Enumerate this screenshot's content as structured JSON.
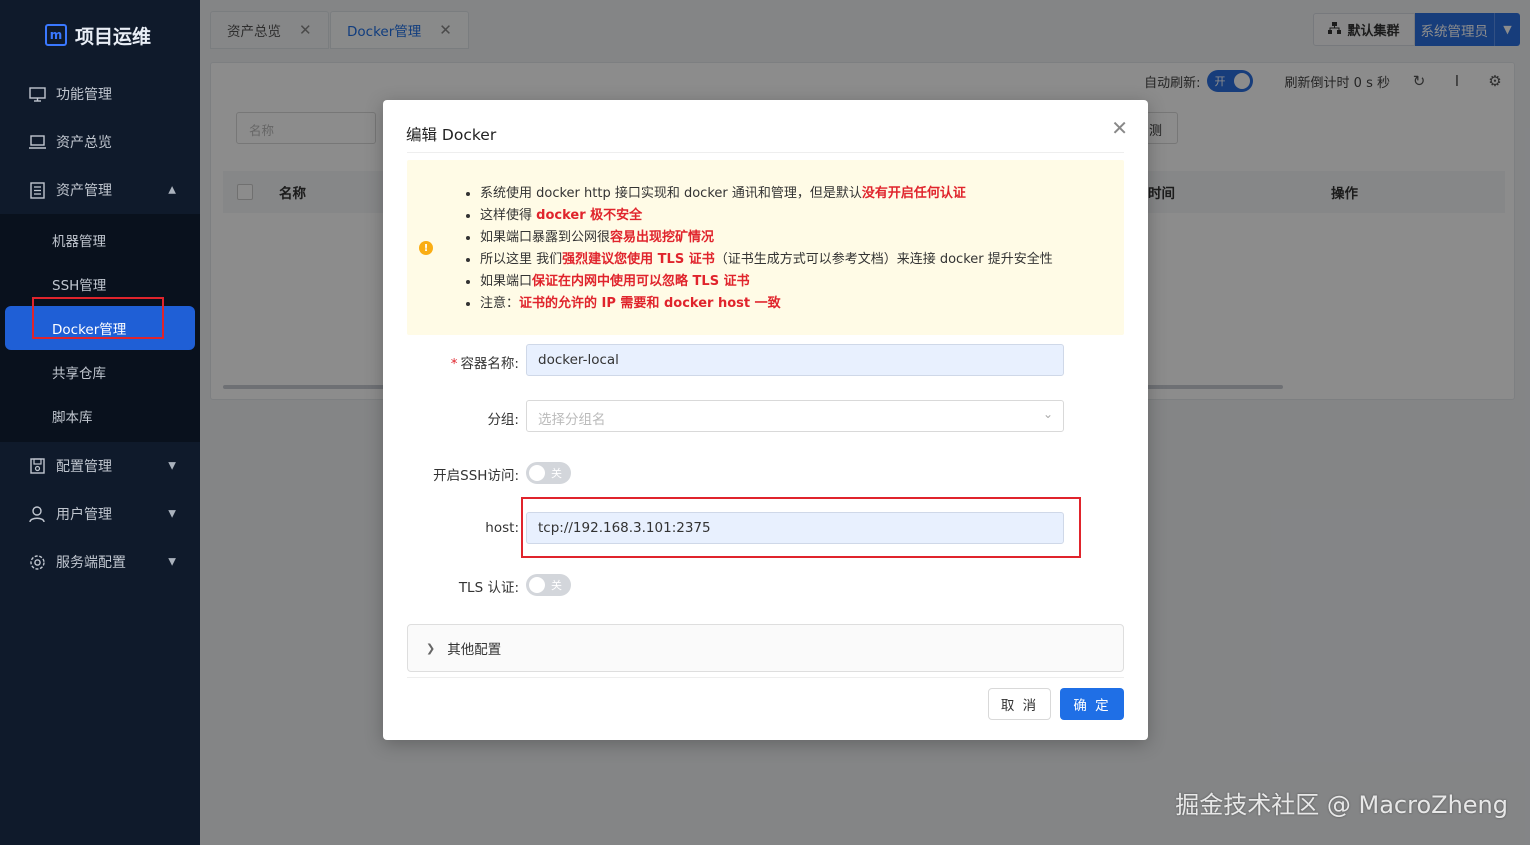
{
  "app": {
    "title": "项目运维",
    "logo_glyph": "m"
  },
  "sidebar": {
    "items": [
      {
        "label": "功能管理",
        "icon": "monitor-icon"
      },
      {
        "label": "资产总览",
        "icon": "laptop-icon"
      },
      {
        "label": "资产管理",
        "icon": "document-icon",
        "expanded": true
      },
      {
        "label": "配置管理",
        "icon": "save-icon"
      },
      {
        "label": "用户管理",
        "icon": "user-icon"
      },
      {
        "label": "服务端配置",
        "icon": "gear-icon"
      }
    ],
    "sub_items": [
      "机器管理",
      "SSH管理",
      "Docker管理",
      "共享仓库",
      "脚本库"
    ],
    "active_sub": "Docker管理"
  },
  "tabs": [
    {
      "label": "资产总览",
      "active": false
    },
    {
      "label": "Docker管理",
      "active": true
    }
  ],
  "header": {
    "cluster_label": "默认集群",
    "user_label": "系统管理员"
  },
  "toolbar": {
    "auto_refresh_label": "自动刷新:",
    "auto_refresh_state": "开",
    "countdown_label": "刷新倒计时 0 s 秒"
  },
  "list": {
    "search_placeholder": "名称",
    "detect_btn_fragment": "测",
    "columns": {
      "name": "名称",
      "time": "时间",
      "op": "操作"
    }
  },
  "modal": {
    "title": "编辑 Docker",
    "alert": [
      [
        {
          "t": "系统使用 docker http 接口实现和 docker 通讯和管理，但是默认"
        },
        {
          "t": "没有开启任何认证",
          "hl": true
        }
      ],
      [
        {
          "t": "这样使得 "
        },
        {
          "t": "docker 极不安全",
          "hl": true
        }
      ],
      [
        {
          "t": "如果端口暴露到公网很"
        },
        {
          "t": "容易出现挖矿情况",
          "hl": true
        }
      ],
      [
        {
          "t": "所以这里 我们"
        },
        {
          "t": "强烈建议您使用 TLS 证书",
          "hl": true
        },
        {
          "t": "（证书生成方式可以参考文档）来连接 docker 提升安全性"
        }
      ],
      [
        {
          "t": "如果端口"
        },
        {
          "t": "保证在内网中使用可以忽略 TLS 证书",
          "hl": true
        }
      ],
      [
        {
          "t": "注意："
        },
        {
          "t": "证书的允许的 IP 需要和 docker host 一致",
          "hl": true
        }
      ]
    ],
    "fields": {
      "name_label": "容器名称:",
      "name_value": "docker-local",
      "group_label": "分组:",
      "group_placeholder": "选择分组名",
      "ssh_label": "开启SSH访问:",
      "ssh_state": "关",
      "host_label": "host:",
      "host_value": "tcp://192.168.3.101:2375",
      "tls_label": "TLS 认证:",
      "tls_state": "关"
    },
    "other_config": "其他配置",
    "cancel": "取 消",
    "ok": "确 定"
  },
  "watermark": "掘金技术社区 @ MacroZheng",
  "colors": {
    "primary": "#1f6fe6",
    "danger": "#e0242c",
    "sidebar_bg": "#0f1a2b",
    "alert_bg": "#fffbe6"
  }
}
